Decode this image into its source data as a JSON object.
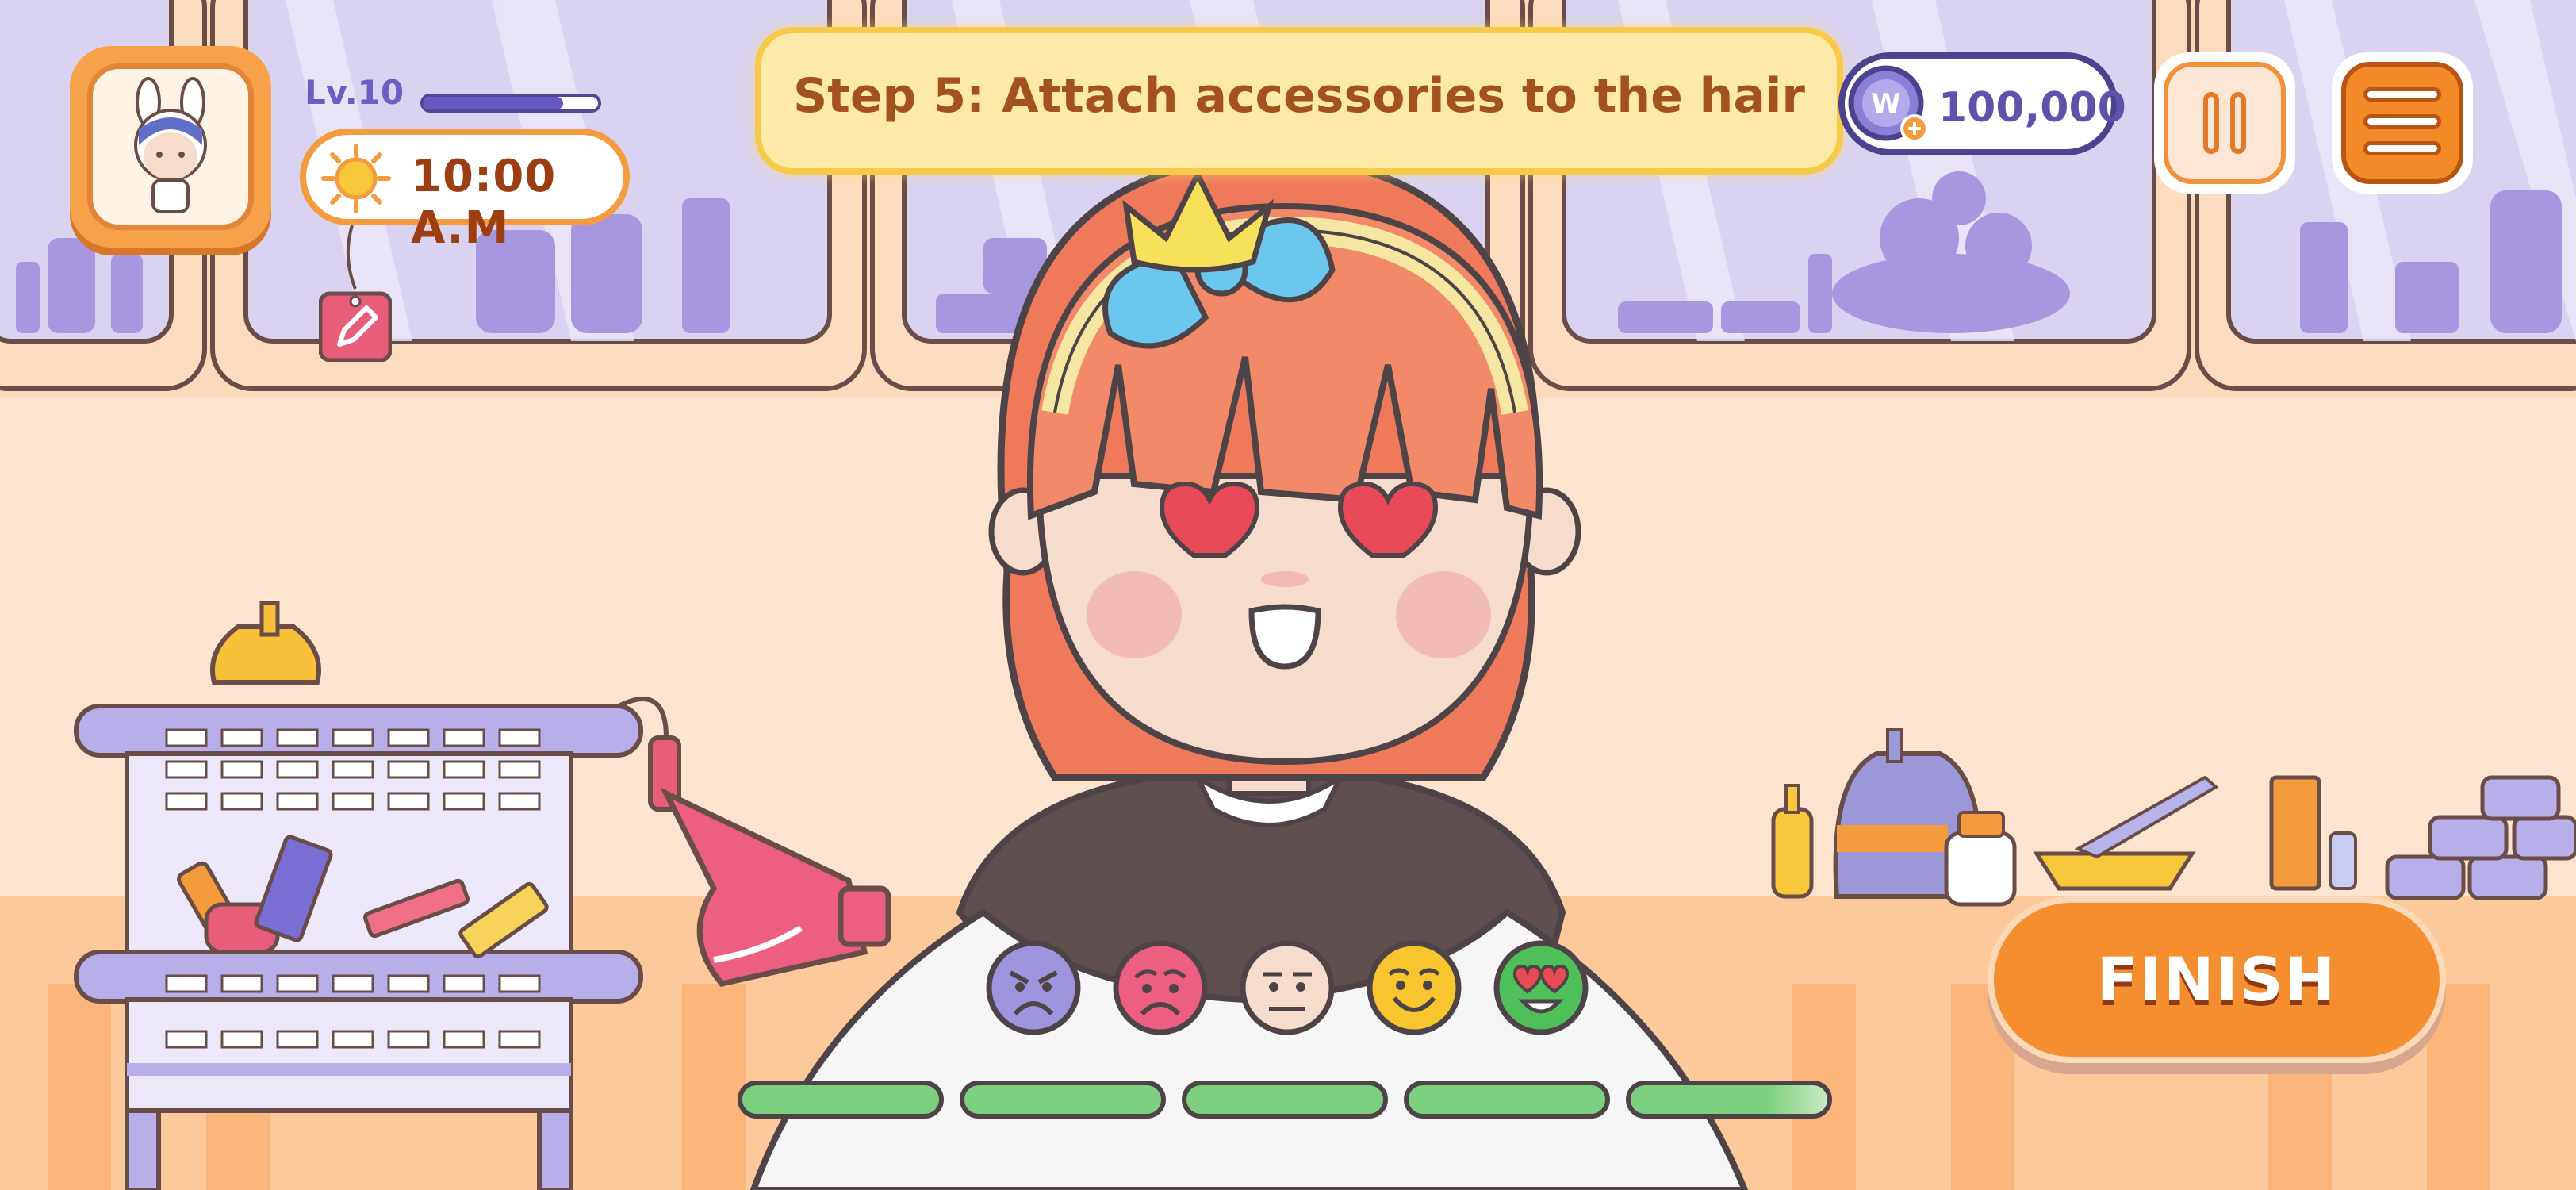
{
  "hud": {
    "level_label": "Lv.10",
    "level_progress": 0.8,
    "time": "10:00 A.M",
    "coins": "100,000"
  },
  "step": {
    "text": "Step 5: Attach accessories to the hair"
  },
  "finish_label": "FINISH",
  "mood_rating": [
    "angry",
    "sad",
    "neutral",
    "happy",
    "love"
  ],
  "satisfaction": {
    "segments": 5,
    "filled_fraction": 0.97
  },
  "colors": {
    "accent_orange": "#f58e2e",
    "purple": "#5c53aa",
    "hair": "#ef7a5b",
    "banner": "#fde9a8"
  },
  "icons": [
    "sun-icon",
    "pencil-icon",
    "coin-icon",
    "pause-icon",
    "menu-icon"
  ]
}
